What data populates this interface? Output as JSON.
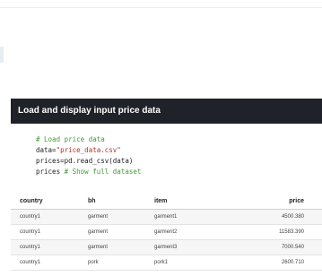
{
  "cell": {
    "title": "Load and display input price data"
  },
  "code": {
    "line1": "# Load price data",
    "line2_pre": "data=",
    "line2_str": "\"price_data.csv\"",
    "line3": "prices=pd.read_csv(data)",
    "line4_pre": "prices ",
    "line4_comment": "# Show full dataset"
  },
  "table": {
    "headers": {
      "country": "country",
      "bh": "bh",
      "item": "item",
      "price": "price"
    },
    "rows": [
      {
        "country": "country1",
        "bh": "garment",
        "item": "garment1",
        "price": "4500.380"
      },
      {
        "country": "country1",
        "bh": "garment",
        "item": "garment2",
        "price": "11583.390"
      },
      {
        "country": "country1",
        "bh": "garment",
        "item": "garment3",
        "price": "7000.540"
      },
      {
        "country": "country1",
        "bh": "pork",
        "item": "pork1",
        "price": "2600.710"
      }
    ]
  }
}
